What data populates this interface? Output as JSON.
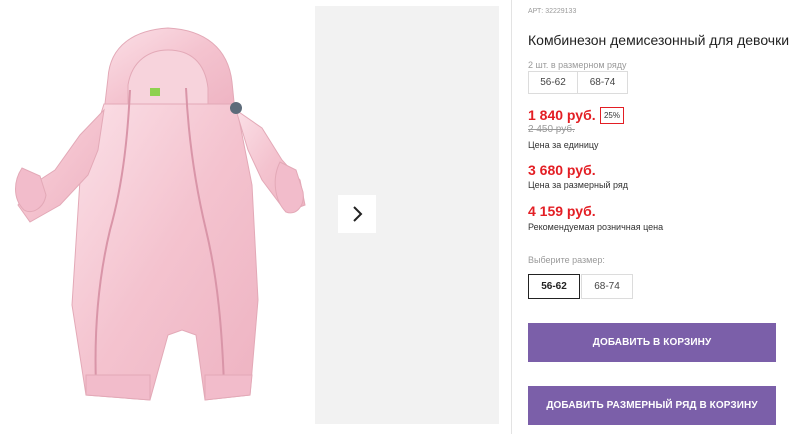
{
  "product": {
    "sku": "АРТ: 32229133",
    "title": "Комбинезон демисезонный для девочки",
    "pack_note": "2 шт. в размерном ряду",
    "pack_sizes": [
      "56-62",
      "68-74"
    ]
  },
  "pricing": {
    "unit_price": "1 840 руб.",
    "discount": "25%",
    "old_price": "2 450 руб.",
    "unit_caption": "Цена за единицу",
    "pack_price": "3 680 руб.",
    "pack_caption": "Цена за размерный ряд",
    "retail_price": "4 159 руб.",
    "retail_caption": "Рекомендуемая розничная цена"
  },
  "size_select": {
    "label": "Выберите размер:",
    "options": [
      "56-62",
      "68-74"
    ],
    "selected": "56-62"
  },
  "actions": {
    "add_to_cart": "Добавить в корзину",
    "add_pack_to_cart": "Добавить размерный ряд в корзину"
  },
  "gallery": {
    "next_icon": "chevron-right-icon"
  },
  "colors": {
    "price_red": "#e31e24",
    "button_purple": "#7b5fa9",
    "garment_pink": "#f6c9d3"
  }
}
